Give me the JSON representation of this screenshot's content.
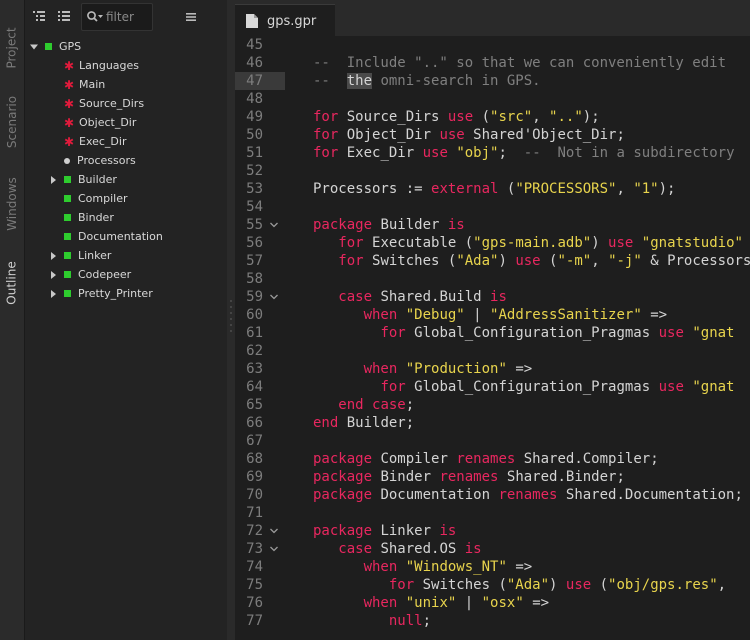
{
  "sidebar_tabs": [
    "Project",
    "Scenario",
    "Windows",
    "Outline"
  ],
  "outline": {
    "filter_placeholder": "filter",
    "root": "GPS",
    "items": [
      {
        "label": "Languages",
        "icon": "attribute"
      },
      {
        "label": "Main",
        "icon": "attribute"
      },
      {
        "label": "Source_Dirs",
        "icon": "attribute"
      },
      {
        "label": "Object_Dir",
        "icon": "attribute"
      },
      {
        "label": "Exec_Dir",
        "icon": "attribute"
      },
      {
        "label": "Processors",
        "icon": "variable"
      },
      {
        "label": "Builder",
        "icon": "package",
        "expandable": true
      },
      {
        "label": "Compiler",
        "icon": "package"
      },
      {
        "label": "Binder",
        "icon": "package"
      },
      {
        "label": "Documentation",
        "icon": "package"
      },
      {
        "label": "Linker",
        "icon": "package",
        "expandable": true
      },
      {
        "label": "Codepeer",
        "icon": "package",
        "expandable": true
      },
      {
        "label": "Pretty_Printer",
        "icon": "package",
        "expandable": true
      }
    ]
  },
  "editor": {
    "tab_title": "gps.gpr",
    "current_line": 47,
    "colors": {
      "keyword": "#e8275f",
      "string": "#e8d44d",
      "comment": "#7f7f7f"
    },
    "lines": [
      {
        "n": 45,
        "fold": false,
        "parts": []
      },
      {
        "n": 46,
        "fold": false,
        "parts": [
          {
            "t": "c",
            "v": "--  Include \"..\" so that we can conveniently edit"
          }
        ]
      },
      {
        "n": 47,
        "fold": false,
        "parts": [
          {
            "t": "c",
            "v": "--  "
          },
          {
            "t": "w",
            "v": "the"
          },
          {
            "t": "c",
            "v": " omni-search in GPS."
          }
        ]
      },
      {
        "n": 48,
        "fold": false,
        "parts": []
      },
      {
        "n": 49,
        "fold": false,
        "parts": [
          {
            "t": "k",
            "v": "for"
          },
          {
            "t": "p",
            "v": " Source_Dirs "
          },
          {
            "t": "k",
            "v": "use"
          },
          {
            "t": "p",
            "v": " ("
          },
          {
            "t": "s",
            "v": "\"src\""
          },
          {
            "t": "p",
            "v": ", "
          },
          {
            "t": "s",
            "v": "\"..\""
          },
          {
            "t": "p",
            "v": ");"
          }
        ]
      },
      {
        "n": 50,
        "fold": false,
        "parts": [
          {
            "t": "k",
            "v": "for"
          },
          {
            "t": "p",
            "v": " Object_Dir "
          },
          {
            "t": "k",
            "v": "use"
          },
          {
            "t": "p",
            "v": " Shared'Object_Dir;"
          }
        ]
      },
      {
        "n": 51,
        "fold": false,
        "parts": [
          {
            "t": "k",
            "v": "for"
          },
          {
            "t": "p",
            "v": " Exec_Dir "
          },
          {
            "t": "k",
            "v": "use"
          },
          {
            "t": "p",
            "v": " "
          },
          {
            "t": "s",
            "v": "\"obj\""
          },
          {
            "t": "p",
            "v": ";  "
          },
          {
            "t": "c",
            "v": "--  Not in a subdirectory"
          }
        ]
      },
      {
        "n": 52,
        "fold": false,
        "parts": []
      },
      {
        "n": 53,
        "fold": false,
        "parts": [
          {
            "t": "p",
            "v": "Processors := "
          },
          {
            "t": "k",
            "v": "external"
          },
          {
            "t": "p",
            "v": " ("
          },
          {
            "t": "s",
            "v": "\"PROCESSORS\""
          },
          {
            "t": "p",
            "v": ", "
          },
          {
            "t": "s",
            "v": "\"1\""
          },
          {
            "t": "p",
            "v": ");"
          }
        ]
      },
      {
        "n": 54,
        "fold": false,
        "parts": []
      },
      {
        "n": 55,
        "fold": true,
        "parts": [
          {
            "t": "k",
            "v": "package"
          },
          {
            "t": "p",
            "v": " Builder "
          },
          {
            "t": "k",
            "v": "is"
          }
        ]
      },
      {
        "n": 56,
        "fold": false,
        "parts": [
          {
            "t": "p",
            "v": "   "
          },
          {
            "t": "k",
            "v": "for"
          },
          {
            "t": "p",
            "v": " Executable ("
          },
          {
            "t": "s",
            "v": "\"gps-main.adb\""
          },
          {
            "t": "p",
            "v": ") "
          },
          {
            "t": "k",
            "v": "use"
          },
          {
            "t": "p",
            "v": " "
          },
          {
            "t": "s",
            "v": "\"gnatstudio\""
          }
        ]
      },
      {
        "n": 57,
        "fold": false,
        "parts": [
          {
            "t": "p",
            "v": "   "
          },
          {
            "t": "k",
            "v": "for"
          },
          {
            "t": "p",
            "v": " Switches ("
          },
          {
            "t": "s",
            "v": "\"Ada\""
          },
          {
            "t": "p",
            "v": ") "
          },
          {
            "t": "k",
            "v": "use"
          },
          {
            "t": "p",
            "v": " ("
          },
          {
            "t": "s",
            "v": "\"-m\""
          },
          {
            "t": "p",
            "v": ", "
          },
          {
            "t": "s",
            "v": "\"-j\""
          },
          {
            "t": "p",
            "v": " & Processors"
          }
        ]
      },
      {
        "n": 58,
        "fold": false,
        "parts": []
      },
      {
        "n": 59,
        "fold": true,
        "parts": [
          {
            "t": "p",
            "v": "   "
          },
          {
            "t": "k",
            "v": "case"
          },
          {
            "t": "p",
            "v": " Shared.Build "
          },
          {
            "t": "k",
            "v": "is"
          }
        ]
      },
      {
        "n": 60,
        "fold": false,
        "parts": [
          {
            "t": "p",
            "v": "      "
          },
          {
            "t": "k",
            "v": "when"
          },
          {
            "t": "p",
            "v": " "
          },
          {
            "t": "s",
            "v": "\"Debug\""
          },
          {
            "t": "p",
            "v": " | "
          },
          {
            "t": "s",
            "v": "\"AddressSanitizer\""
          },
          {
            "t": "p",
            "v": " =>"
          }
        ]
      },
      {
        "n": 61,
        "fold": false,
        "parts": [
          {
            "t": "p",
            "v": "        "
          },
          {
            "t": "k",
            "v": "for"
          },
          {
            "t": "p",
            "v": " Global_Configuration_Pragmas "
          },
          {
            "t": "k",
            "v": "use"
          },
          {
            "t": "p",
            "v": " "
          },
          {
            "t": "s",
            "v": "\"gnat"
          }
        ]
      },
      {
        "n": 62,
        "fold": false,
        "parts": []
      },
      {
        "n": 63,
        "fold": false,
        "parts": [
          {
            "t": "p",
            "v": "      "
          },
          {
            "t": "k",
            "v": "when"
          },
          {
            "t": "p",
            "v": " "
          },
          {
            "t": "s",
            "v": "\"Production\""
          },
          {
            "t": "p",
            "v": " =>"
          }
        ]
      },
      {
        "n": 64,
        "fold": false,
        "parts": [
          {
            "t": "p",
            "v": "        "
          },
          {
            "t": "k",
            "v": "for"
          },
          {
            "t": "p",
            "v": " Global_Configuration_Pragmas "
          },
          {
            "t": "k",
            "v": "use"
          },
          {
            "t": "p",
            "v": " "
          },
          {
            "t": "s",
            "v": "\"gnat"
          }
        ]
      },
      {
        "n": 65,
        "fold": false,
        "parts": [
          {
            "t": "p",
            "v": "   "
          },
          {
            "t": "k",
            "v": "end case"
          },
          {
            "t": "p",
            "v": ";"
          }
        ]
      },
      {
        "n": 66,
        "fold": false,
        "parts": [
          {
            "t": "k",
            "v": "end"
          },
          {
            "t": "p",
            "v": " Builder;"
          }
        ]
      },
      {
        "n": 67,
        "fold": false,
        "parts": []
      },
      {
        "n": 68,
        "fold": false,
        "parts": [
          {
            "t": "k",
            "v": "package"
          },
          {
            "t": "p",
            "v": " Compiler "
          },
          {
            "t": "k",
            "v": "renames"
          },
          {
            "t": "p",
            "v": " Shared.Compiler;"
          }
        ]
      },
      {
        "n": 69,
        "fold": false,
        "parts": [
          {
            "t": "k",
            "v": "package"
          },
          {
            "t": "p",
            "v": " Binder "
          },
          {
            "t": "k",
            "v": "renames"
          },
          {
            "t": "p",
            "v": " Shared.Binder;"
          }
        ]
      },
      {
        "n": 70,
        "fold": false,
        "parts": [
          {
            "t": "k",
            "v": "package"
          },
          {
            "t": "p",
            "v": " Documentation "
          },
          {
            "t": "k",
            "v": "renames"
          },
          {
            "t": "p",
            "v": " Shared.Documentation;"
          }
        ]
      },
      {
        "n": 71,
        "fold": false,
        "parts": []
      },
      {
        "n": 72,
        "fold": true,
        "parts": [
          {
            "t": "k",
            "v": "package"
          },
          {
            "t": "p",
            "v": " Linker "
          },
          {
            "t": "k",
            "v": "is"
          }
        ]
      },
      {
        "n": 73,
        "fold": true,
        "parts": [
          {
            "t": "p",
            "v": "   "
          },
          {
            "t": "k",
            "v": "case"
          },
          {
            "t": "p",
            "v": " Shared.OS "
          },
          {
            "t": "k",
            "v": "is"
          }
        ]
      },
      {
        "n": 74,
        "fold": false,
        "parts": [
          {
            "t": "p",
            "v": "      "
          },
          {
            "t": "k",
            "v": "when"
          },
          {
            "t": "p",
            "v": " "
          },
          {
            "t": "s",
            "v": "\"Windows_NT\""
          },
          {
            "t": "p",
            "v": " =>"
          }
        ]
      },
      {
        "n": 75,
        "fold": false,
        "parts": [
          {
            "t": "p",
            "v": "         "
          },
          {
            "t": "k",
            "v": "for"
          },
          {
            "t": "p",
            "v": " Switches ("
          },
          {
            "t": "s",
            "v": "\"Ada\""
          },
          {
            "t": "p",
            "v": ") "
          },
          {
            "t": "k",
            "v": "use"
          },
          {
            "t": "p",
            "v": " ("
          },
          {
            "t": "s",
            "v": "\"obj/gps.res\""
          },
          {
            "t": "p",
            "v": ","
          }
        ]
      },
      {
        "n": 76,
        "fold": false,
        "parts": [
          {
            "t": "p",
            "v": "      "
          },
          {
            "t": "k",
            "v": "when"
          },
          {
            "t": "p",
            "v": " "
          },
          {
            "t": "s",
            "v": "\"unix\""
          },
          {
            "t": "p",
            "v": " | "
          },
          {
            "t": "s",
            "v": "\"osx\""
          },
          {
            "t": "p",
            "v": " =>"
          }
        ]
      },
      {
        "n": 77,
        "fold": false,
        "parts": [
          {
            "t": "p",
            "v": "         "
          },
          {
            "t": "k",
            "v": "null"
          },
          {
            "t": "p",
            "v": ";"
          }
        ]
      }
    ]
  }
}
